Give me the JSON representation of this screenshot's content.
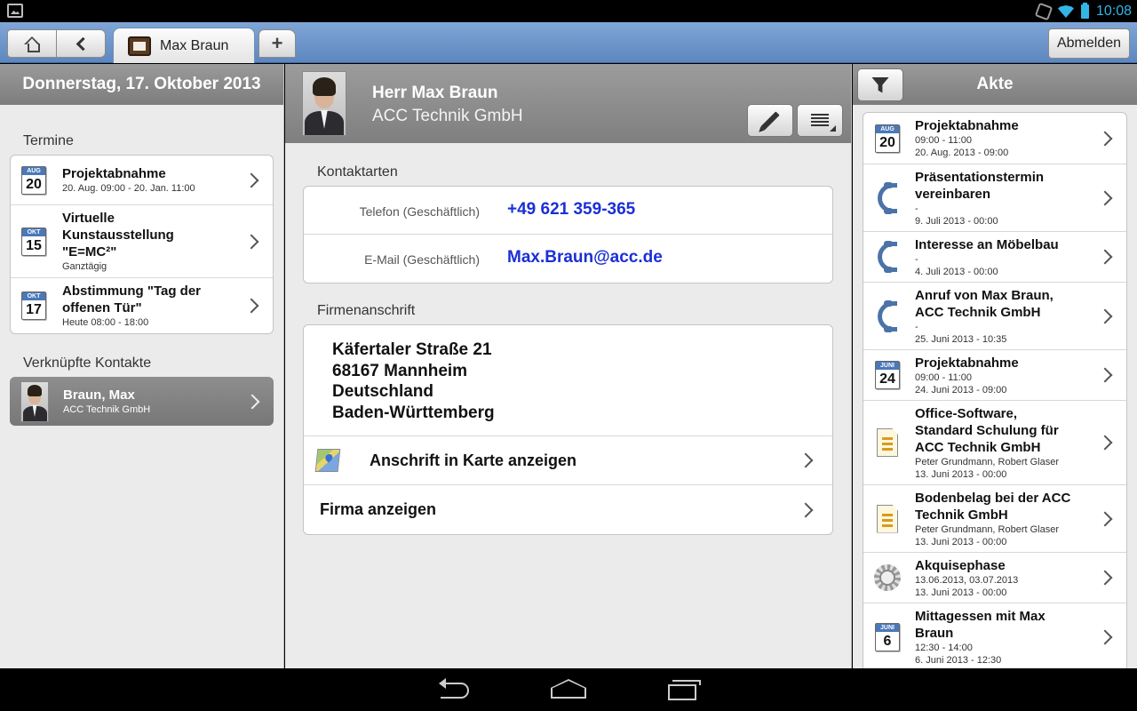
{
  "statusbar": {
    "time": "10:08"
  },
  "toolbar": {
    "tab_label": "Max Braun",
    "add_label": "+",
    "logout_label": "Abmelden"
  },
  "left": {
    "date_header": "Donnerstag, 17. Oktober 2013",
    "appointments_title": "Termine",
    "appointments": [
      {
        "month": "AUG",
        "day": "20",
        "title": "Projektabnahme",
        "sub": "20. Aug. 09:00 - 20. Jan. 11:00"
      },
      {
        "month": "OKT",
        "day": "15",
        "title": "Virtuelle Kunstausstellung \"E=MC²\"",
        "sub": "Ganztägig"
      },
      {
        "month": "OKT",
        "day": "17",
        "title": "Abstimmung \"Tag der offenen Tür\"",
        "sub": "Heute 08:00 - 18:00"
      }
    ],
    "contacts_title": "Verknüpfte Kontakte",
    "contact": {
      "name": "Braun, Max",
      "company": "ACC Technik GmbH"
    }
  },
  "middle": {
    "name": "Herr Max Braun",
    "company": "ACC Technik GmbH",
    "contact_types_title": "Kontaktarten",
    "contact_types": [
      {
        "label": "Telefon (Geschäftlich)",
        "value": "+49 621 359-365"
      },
      {
        "label": "E-Mail (Geschäftlich)",
        "value": "Max.Braun@acc.de"
      }
    ],
    "address_title": "Firmenanschrift",
    "address_lines": [
      "Käfertaler Straße 21",
      "68167 Mannheim",
      "Deutschland",
      "Baden-Württemberg"
    ],
    "show_map_label": "Anschrift in Karte anzeigen",
    "show_company_label": "Firma anzeigen"
  },
  "right": {
    "header": "Akte",
    "items": [
      {
        "icon": "calendar-icon",
        "month": "AUG",
        "day": "20",
        "title": "Projektabnahme",
        "line1": "09:00 - 11:00",
        "line2": "20. Aug. 2013 - 09:00"
      },
      {
        "icon": "phone-icon",
        "title": "Präsentationstermin vereinbaren",
        "line1": "-",
        "line2": "9. Juli 2013 - 00:00"
      },
      {
        "icon": "phone-icon",
        "title": "Interesse an Möbelbau",
        "line1": "-",
        "line2": "4. Juli 2013 - 00:00"
      },
      {
        "icon": "phone-icon",
        "title": "Anruf von Max Braun, ACC Technik GmbH",
        "line1": "-",
        "line2": "25. Juni 2013 - 10:35"
      },
      {
        "icon": "calendar-icon",
        "month": "JUNI",
        "day": "24",
        "title": "Projektabnahme",
        "line1": "09:00 - 11:00",
        "line2": "24. Juni 2013 - 09:00"
      },
      {
        "icon": "document-icon",
        "title": "Office-Software, Standard Schulung für ACC Technik GmbH",
        "line1": "Peter Grundmann, Robert Glaser",
        "line2": "13. Juni 2013 - 00:00"
      },
      {
        "icon": "document-icon",
        "title": "Bodenbelag bei der ACC Technik GmbH",
        "line1": "Peter Grundmann, Robert Glaser",
        "line2": "13. Juni 2013 - 00:00"
      },
      {
        "icon": "gear-icon",
        "title": "Akquisephase",
        "line1": "13.06.2013, 03.07.2013",
        "line2": "13. Juni 2013 - 00:00"
      },
      {
        "icon": "calendar-icon",
        "month": "JUNI",
        "day": "6",
        "title": "Mittagessen mit Max Braun",
        "line1": "12:30 - 14:00",
        "line2": "6. Juni 2013 - 12:30"
      }
    ]
  }
}
